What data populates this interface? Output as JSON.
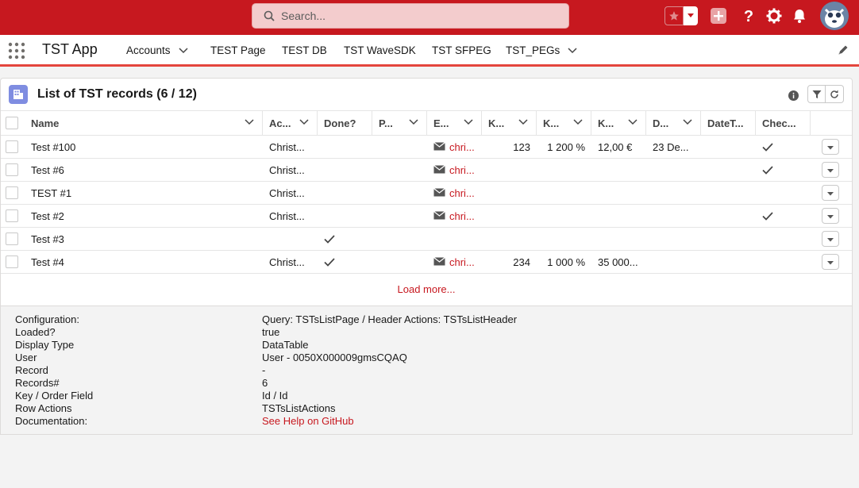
{
  "header": {
    "search_placeholder": "Search...",
    "icons": [
      "search-icon",
      "star-icon",
      "chevron-down-icon",
      "plus-icon",
      "help-icon",
      "gear-icon",
      "bell-icon",
      "avatar"
    ]
  },
  "nav": {
    "app_name": "TST App",
    "items": [
      {
        "label": "Accounts",
        "has_menu": true
      },
      {
        "label": "TEST Page",
        "has_menu": false
      },
      {
        "label": "TEST DB",
        "has_menu": false
      },
      {
        "label": "TST WaveSDK",
        "has_menu": false
      },
      {
        "label": "TST SFPEG",
        "has_menu": false
      },
      {
        "label": "TST_PEGs",
        "has_menu": true
      }
    ]
  },
  "card": {
    "title": "List of TST records (6 / 12)",
    "load_more": "Load more..."
  },
  "table": {
    "columns": [
      "Name",
      "Ac...",
      "Done?",
      "P...",
      "E...",
      "K...",
      "K...",
      "K...",
      "D...",
      "DateT...",
      "Chec..."
    ],
    "rows": [
      {
        "name": "Test #100",
        "account": "Christ...",
        "done": false,
        "email": "chri...",
        "k1": "123",
        "k2": "1 200 %",
        "k3": "12,00 €",
        "d": "23 De...",
        "check": true
      },
      {
        "name": "Test #6",
        "account": "Christ...",
        "done": false,
        "email": "chri...",
        "k1": "",
        "k2": "",
        "k3": "",
        "d": "",
        "check": true
      },
      {
        "name": "TEST #1",
        "account": "Christ...",
        "done": false,
        "email": "chri...",
        "k1": "",
        "k2": "",
        "k3": "",
        "d": "",
        "check": false
      },
      {
        "name": "Test #2",
        "account": "Christ...",
        "done": false,
        "email": "chri...",
        "k1": "",
        "k2": "",
        "k3": "",
        "d": "",
        "check": true
      },
      {
        "name": "Test #3",
        "account": "",
        "done": true,
        "email": "",
        "k1": "",
        "k2": "",
        "k3": "",
        "d": "",
        "check": false
      },
      {
        "name": "Test #4",
        "account": "Christ...",
        "done": true,
        "email": "chri...",
        "k1": "234",
        "k2": "1 000 %",
        "k3": "35 000...",
        "d": "",
        "check": false
      }
    ]
  },
  "debug": {
    "labels": [
      "Configuration:",
      "Loaded?",
      "Display Type",
      "User",
      "Record",
      "Records#",
      "Key / Order Field",
      "Row Actions",
      "Documentation:"
    ],
    "values": [
      "Query: TSTsListPage / Header Actions: TSTsListHeader",
      "true",
      "DataTable",
      "User - 0050X000009gmsCQAQ",
      "-",
      "6",
      "Id / Id",
      "TSTsListActions",
      "See Help on GitHub"
    ]
  },
  "colors": {
    "brand": "#c7181f",
    "nav_accent": "#e4453d",
    "object_icon": "#7f8de1"
  }
}
